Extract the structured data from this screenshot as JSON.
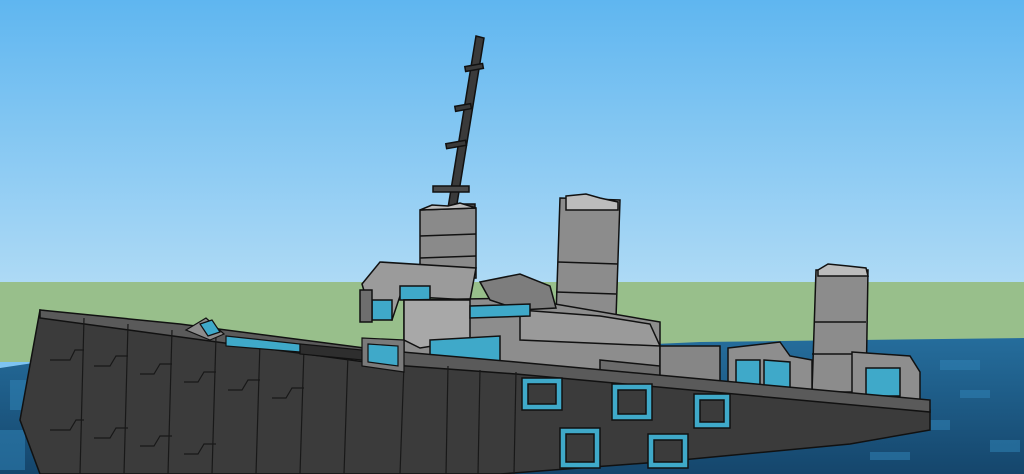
{
  "scene": {
    "colors": {
      "sky_top": "#5fb6f0",
      "sky_bottom": "#a9d8f5",
      "ground": "#96bf8a",
      "water": "#1e5e8c",
      "water_highlight": "#2d7fb3",
      "hull": "#3b3b3b",
      "hull_edge": "#111111",
      "superstructure": "#8a8a8a",
      "superstructure_light": "#b8b8b8",
      "accent": "#3fa9c9"
    }
  }
}
